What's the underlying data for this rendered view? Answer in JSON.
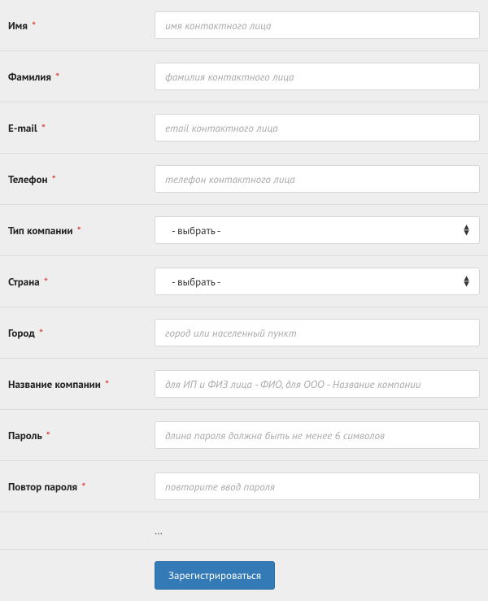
{
  "fields": {
    "first_name": {
      "label": "Имя",
      "placeholder": "имя контактного лица"
    },
    "last_name": {
      "label": "Фамилия",
      "placeholder": "фамилия контактного лица"
    },
    "email": {
      "label": "E-mail",
      "placeholder": "email контактного лица"
    },
    "phone": {
      "label": "Телефон",
      "placeholder": "телефон контактного лица"
    },
    "company_type": {
      "label": "Тип компании",
      "selected": "- выбрать -"
    },
    "country": {
      "label": "Страна",
      "selected": "- выбрать -"
    },
    "city": {
      "label": "Город",
      "placeholder": "город или населенный пункт"
    },
    "company_name": {
      "label": "Название компании",
      "placeholder": "для ИП и ФИЗ лица - ФИО, для ООО - Название компании"
    },
    "password": {
      "label": "Пароль",
      "placeholder": "длина пароля должна быть не менее 6 символов"
    },
    "password_confirm": {
      "label": "Повтор пароля",
      "placeholder": "повторите ввод пароля"
    }
  },
  "captcha_placeholder": "…",
  "submit_label": "Зарегистрироваться"
}
